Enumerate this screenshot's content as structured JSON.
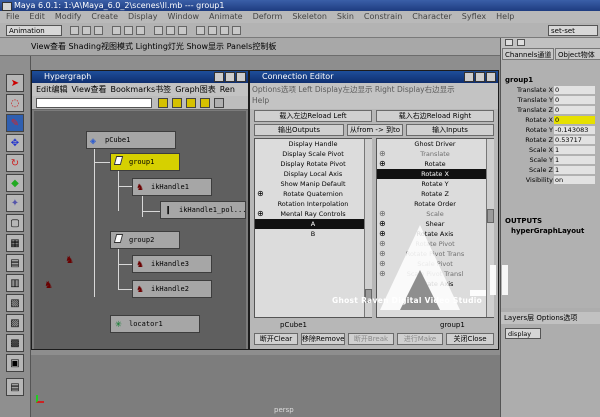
{
  "app": {
    "title": "Maya 6.0.1: 1:\\A\\Maya_6.0_2\\scenes\\ll.mb  ---  group1",
    "menus": [
      "File",
      "Edit",
      "Modify",
      "Create",
      "Display",
      "Window",
      "Animate",
      "Deform",
      "Skeleton",
      "Skin",
      "Constrain",
      "Character",
      "Syflex",
      "Help"
    ],
    "mode": "Animation",
    "selection_sets": "set-set",
    "shelf_label": "View查看  Shading视图模式  Lighting灯光  Show显示  Panels控制板"
  },
  "hypergraph": {
    "title": "Hypergraph",
    "menus": [
      "Edit编辑",
      "View查看",
      "Bookmarks书签",
      "Graph图表",
      "Ren"
    ],
    "nodes": [
      {
        "label": "pCube1",
        "selected": false
      },
      {
        "label": "group1",
        "selected": true
      },
      {
        "label": "ikHandle1",
        "selected": false
      },
      {
        "label": "ikHandle1_pol...",
        "selected": false
      },
      {
        "label": "group2",
        "selected": false
      },
      {
        "label": "ikHandle3",
        "selected": false
      },
      {
        "label": "ikHandle2",
        "selected": false
      },
      {
        "label": "locator1",
        "selected": false
      }
    ]
  },
  "connection_editor": {
    "title": "Connection Editor",
    "menu_line1": "Options选项   Left Display左边显示   Right Display右边显示",
    "menu_line2": "Help",
    "reload_left": "载入左边Reload Left",
    "reload_right": "载入右边Reload Right",
    "outputs": "输出Outputs",
    "from_to": "从from -> 到to",
    "inputs": "输入Inputs",
    "left_items": [
      {
        "label": "Display Handle",
        "plus": false,
        "hl": false
      },
      {
        "label": "Display Scale Pivot",
        "plus": false,
        "hl": false
      },
      {
        "label": "Display Rotate Pivot",
        "plus": false,
        "hl": false
      },
      {
        "label": "Display Local Axis",
        "plus": false,
        "hl": false
      },
      {
        "label": "Show Manip Default",
        "plus": false,
        "hl": false
      },
      {
        "label": "Rotate Quaternion",
        "plus": true,
        "hl": false
      },
      {
        "label": "Rotation Interpolation",
        "plus": false,
        "hl": false
      },
      {
        "label": "Mental Ray Controls",
        "plus": true,
        "hl": false
      },
      {
        "label": "A",
        "plus": false,
        "hl": true
      },
      {
        "label": "B",
        "plus": false,
        "hl": false
      }
    ],
    "right_items": [
      {
        "label": "Ghost Driver",
        "plus": false,
        "hl": false,
        "dim": false
      },
      {
        "label": "Translate",
        "plus": true,
        "hl": false,
        "dim": true
      },
      {
        "label": "Rotate",
        "plus": true,
        "hl": false,
        "dim": false
      },
      {
        "label": "Rotate X",
        "plus": false,
        "hl": true,
        "dim": false
      },
      {
        "label": "Rotate Y",
        "plus": false,
        "hl": false,
        "dim": false
      },
      {
        "label": "Rotate Z",
        "plus": false,
        "hl": false,
        "dim": false
      },
      {
        "label": "Rotate Order",
        "plus": false,
        "hl": false,
        "dim": false
      },
      {
        "label": "Scale",
        "plus": true,
        "hl": false,
        "dim": true
      },
      {
        "label": "Shear",
        "plus": true,
        "hl": false,
        "dim": false
      },
      {
        "label": "Rotate Axis",
        "plus": true,
        "hl": false,
        "dim": false
      },
      {
        "label": "Rotate Pivot",
        "plus": true,
        "hl": false,
        "dim": true
      },
      {
        "label": "Rotate Pivot Trans",
        "plus": true,
        "hl": false,
        "dim": true
      },
      {
        "label": "Scale Pivot",
        "plus": true,
        "hl": false,
        "dim": true
      },
      {
        "label": "Scale Pivot Transl",
        "plus": true,
        "hl": false,
        "dim": true
      },
      {
        "label": "Rotate Axis",
        "plus": false,
        "hl": false,
        "dim": false
      }
    ],
    "left_node": "pCube1",
    "right_node": "group1",
    "bottom_buttons": [
      "断开Clear",
      "移除Remove",
      "断开Break",
      "进行Make",
      "关闭Close"
    ]
  },
  "channels": {
    "tab1": "Channels通道",
    "tab2": "Object物体",
    "object": "group1",
    "rows": [
      {
        "label": "Translate X",
        "value": "0",
        "selected": false
      },
      {
        "label": "Translate Y",
        "value": "0",
        "selected": false
      },
      {
        "label": "Translate Z",
        "value": "0",
        "selected": false
      },
      {
        "label": "Rotate X",
        "value": "0",
        "selected": true
      },
      {
        "label": "Rotate Y",
        "value": "-0.143083",
        "selected": false
      },
      {
        "label": "Rotate Z",
        "value": "0.53717",
        "selected": false
      },
      {
        "label": "Scale X",
        "value": "1",
        "selected": false
      },
      {
        "label": "Scale Y",
        "value": "1",
        "selected": false
      },
      {
        "label": "Scale Z",
        "value": "1",
        "selected": false
      },
      {
        "label": "Visibility",
        "value": "on",
        "selected": false
      }
    ],
    "outputs_label": "OUTPUTS",
    "outputs_value": "hyperGraphLayout"
  },
  "layers": {
    "tabs": "Layers层   Options选项",
    "display": "display"
  },
  "viewport_label": "persp",
  "watermark": "Ghost Raven Digital Video Studio"
}
